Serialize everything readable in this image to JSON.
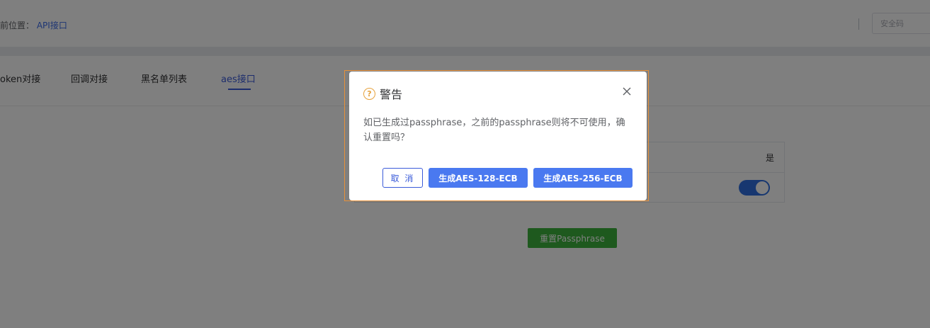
{
  "header": {
    "breadcrumb_prefix": "前位置：",
    "breadcrumb_current": "API接口",
    "security_placeholder": "安全码"
  },
  "tabs": [
    {
      "label": "oken对接",
      "active": false
    },
    {
      "label": "回调对接",
      "active": false
    },
    {
      "label": "黑名单列表",
      "active": false
    },
    {
      "label": "aes接口",
      "active": true
    }
  ],
  "table": {
    "header_yes": "是",
    "toggle_on": true
  },
  "reset_button_label": "重置Passphrase",
  "dialog": {
    "title": "警告",
    "message": "如已生成过passphrase，之前的passphrase则将不可使用，确认重置吗？",
    "cancel_label": "取 消",
    "aes128_label": "生成AES-128-ECB",
    "aes256_label": "生成AES-256-ECB"
  },
  "colors": {
    "primary": "#4a79f0",
    "success": "#3db33d",
    "warning": "#e6a23c"
  }
}
